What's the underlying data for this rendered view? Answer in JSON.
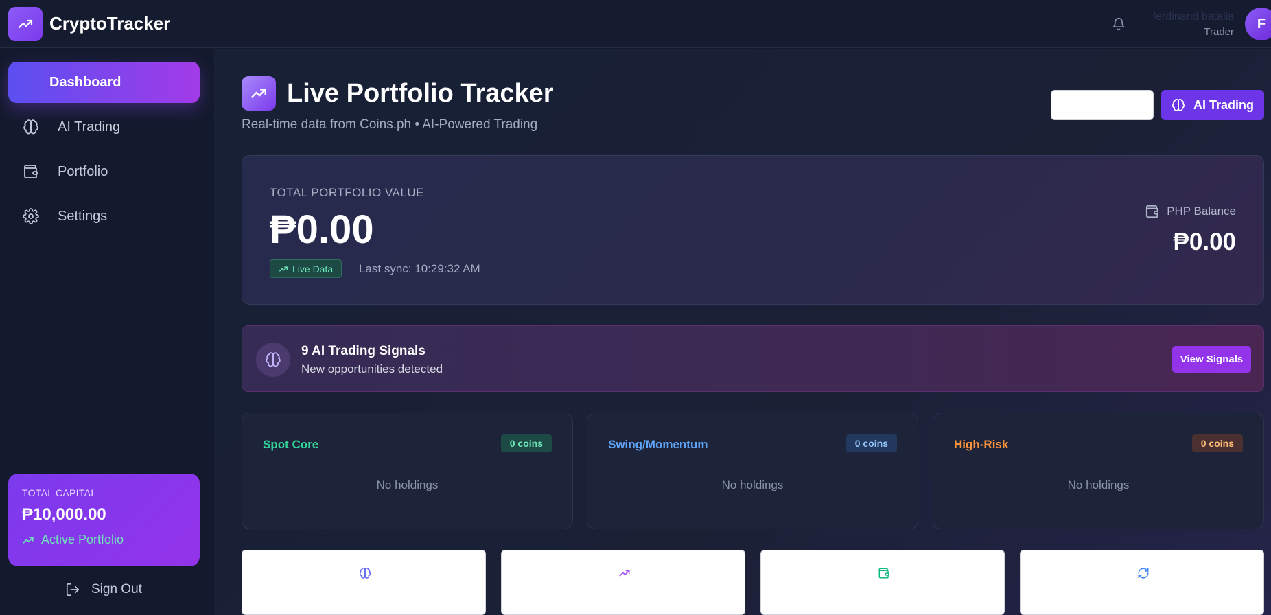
{
  "app": {
    "name": "CryptoTracker"
  },
  "user": {
    "name": "ferdinand batalla",
    "role": "Trader",
    "initial": "F"
  },
  "sidebar": {
    "items": [
      {
        "label": "Dashboard",
        "icon": "none"
      },
      {
        "label": "AI Trading",
        "icon": "brain-icon"
      },
      {
        "label": "Portfolio",
        "icon": "wallet-icon"
      },
      {
        "label": "Settings",
        "icon": "gear-icon"
      }
    ],
    "capital": {
      "label": "TOTAL CAPITAL",
      "value": "₱10,000.00",
      "status": "Active Portfolio"
    },
    "sign_out": "Sign Out"
  },
  "header": {
    "title": "Live Portfolio Tracker",
    "subtitle": "Real-time data from Coins.ph • AI-Powered Trading",
    "ai_button": "AI Trading"
  },
  "portfolio": {
    "label": "TOTAL PORTFOLIO VALUE",
    "value": "₱0.00",
    "live_badge": "Live Data",
    "last_sync": "Last sync: 10:29:32 AM",
    "php_label": "PHP Balance",
    "php_value": "₱0.00"
  },
  "signals": {
    "title": "9 AI Trading Signals",
    "subtitle": "New opportunities detected",
    "button": "View Signals"
  },
  "buckets": [
    {
      "name": "Spot Core",
      "badge": "0 coins",
      "empty": "No holdings",
      "color": "#34d399",
      "badge_bg": "#1e4a46"
    },
    {
      "name": "Swing/Momentum",
      "badge": "0 coins",
      "empty": "No holdings",
      "color": "#60a5fa",
      "badge_bg": "#23385e"
    },
    {
      "name": "High-Risk",
      "badge": "0 coins",
      "empty": "No holdings",
      "color": "#fb923c",
      "badge_bg": "#4a3030"
    }
  ],
  "actions": [
    {
      "icon": "brain-icon",
      "color": "#6366f1"
    },
    {
      "icon": "trending-up-icon",
      "color": "#a855f7"
    },
    {
      "icon": "wallet-icon",
      "color": "#10b981"
    },
    {
      "icon": "refresh-icon",
      "color": "#3b82f6"
    }
  ],
  "colors": {
    "accent": "#7c3aed",
    "positive": "#34d399"
  }
}
